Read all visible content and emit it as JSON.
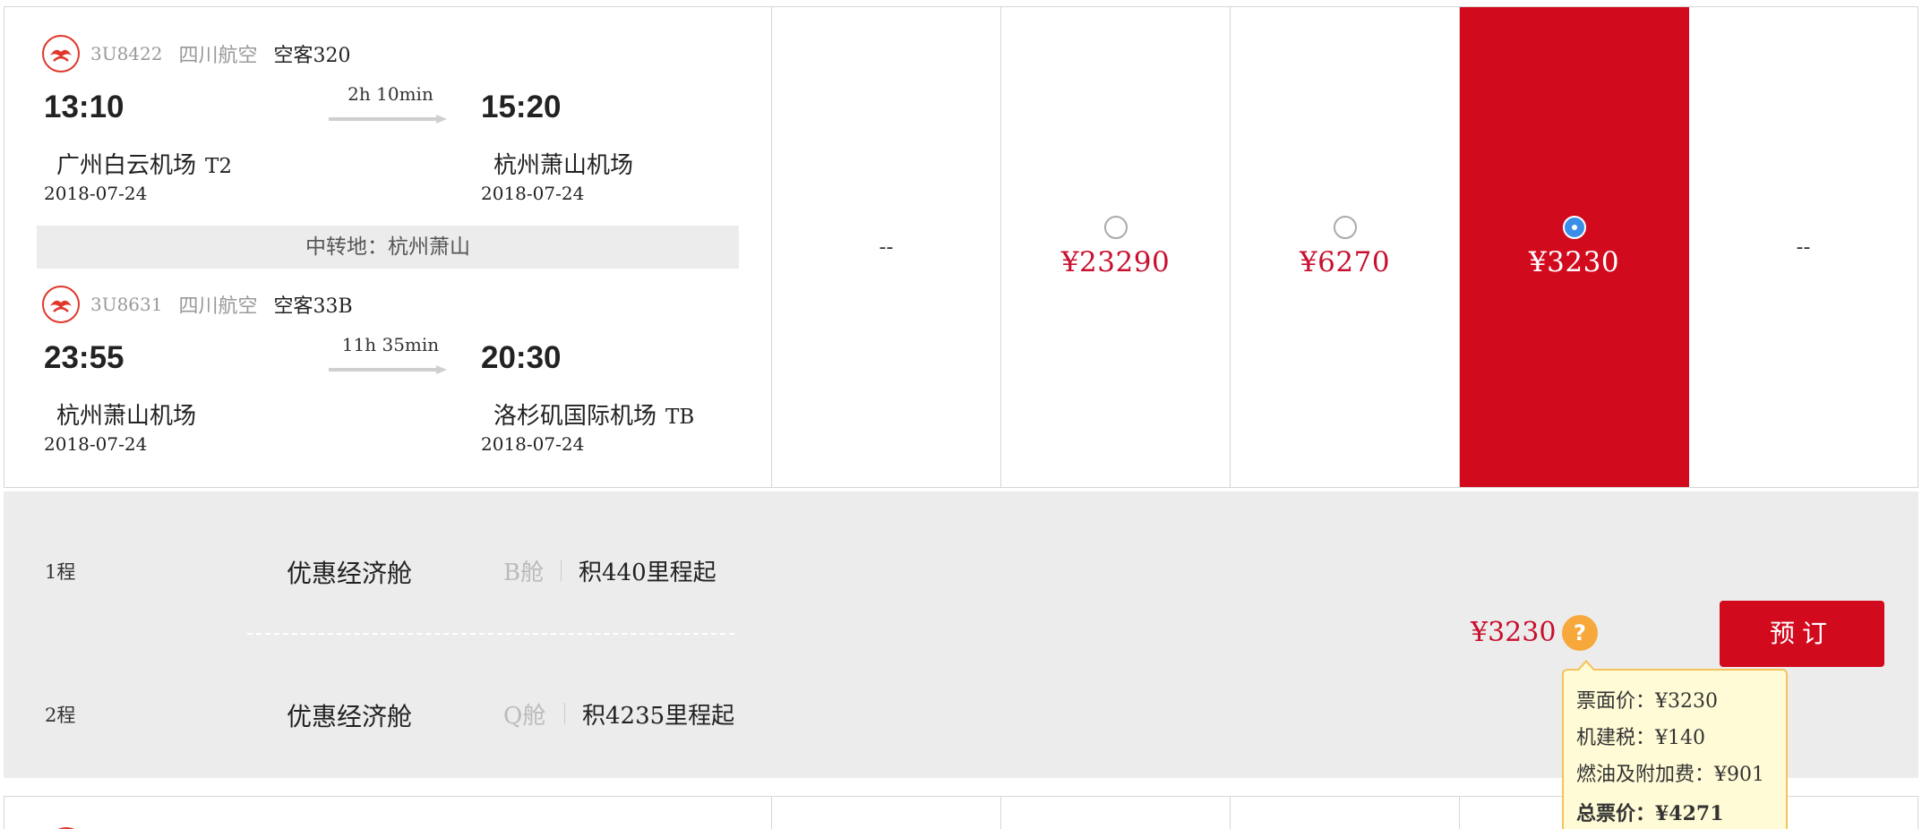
{
  "flight": {
    "segments": [
      {
        "flight_no": "3U8422",
        "airline": "四川航空",
        "aircraft": "空客320",
        "dep_time": "13:10",
        "arr_time": "15:20",
        "duration": "2h 10min",
        "dep_airport": "广州白云机场",
        "dep_terminal": "T2",
        "arr_airport": "杭州萧山机场",
        "arr_terminal": "",
        "dep_date": "2018-07-24",
        "arr_date": "2018-07-24"
      },
      {
        "flight_no": "3U8631",
        "airline": "四川航空",
        "aircraft": "空客33B",
        "dep_time": "23:55",
        "arr_time": "20:30",
        "duration": "11h 35min",
        "dep_airport": "杭州萧山机场",
        "dep_terminal": "",
        "arr_airport": "洛杉矶国际机场",
        "arr_terminal": "TB",
        "dep_date": "2018-07-24",
        "arr_date": "2018-07-24"
      }
    ],
    "transfer": "中转地：杭州萧山",
    "fare_columns": [
      {
        "price": "--",
        "has_radio": false,
        "selected": false
      },
      {
        "price": "¥23290",
        "has_radio": true,
        "selected": false
      },
      {
        "price": "¥6270",
        "has_radio": true,
        "selected": false
      },
      {
        "price": "¥3230",
        "has_radio": true,
        "selected": true
      },
      {
        "price": "--",
        "has_radio": false,
        "selected": false
      }
    ]
  },
  "detail": {
    "legs": [
      {
        "label": "1程",
        "cabin": "优惠经济舱",
        "class": "B舱",
        "miles": "积440里程起"
      },
      {
        "label": "2程",
        "cabin": "优惠经济舱",
        "class": "Q舱",
        "miles": "积4235里程起"
      }
    ],
    "price": "¥3230",
    "help_icon": "?",
    "book_label": "预订"
  },
  "tooltip": {
    "fare": "票面价：¥3230",
    "airport_tax": "机建税：¥140",
    "fuel": "燃油及附加费：¥901",
    "total": "总票价：¥4271"
  },
  "colors": {
    "accent_red": "#d20a1e",
    "price_red": "#c8102e",
    "radio_blue": "#3b8ee8",
    "help_orange": "#f7a83b",
    "tooltip_bg": "#fffbd6"
  }
}
